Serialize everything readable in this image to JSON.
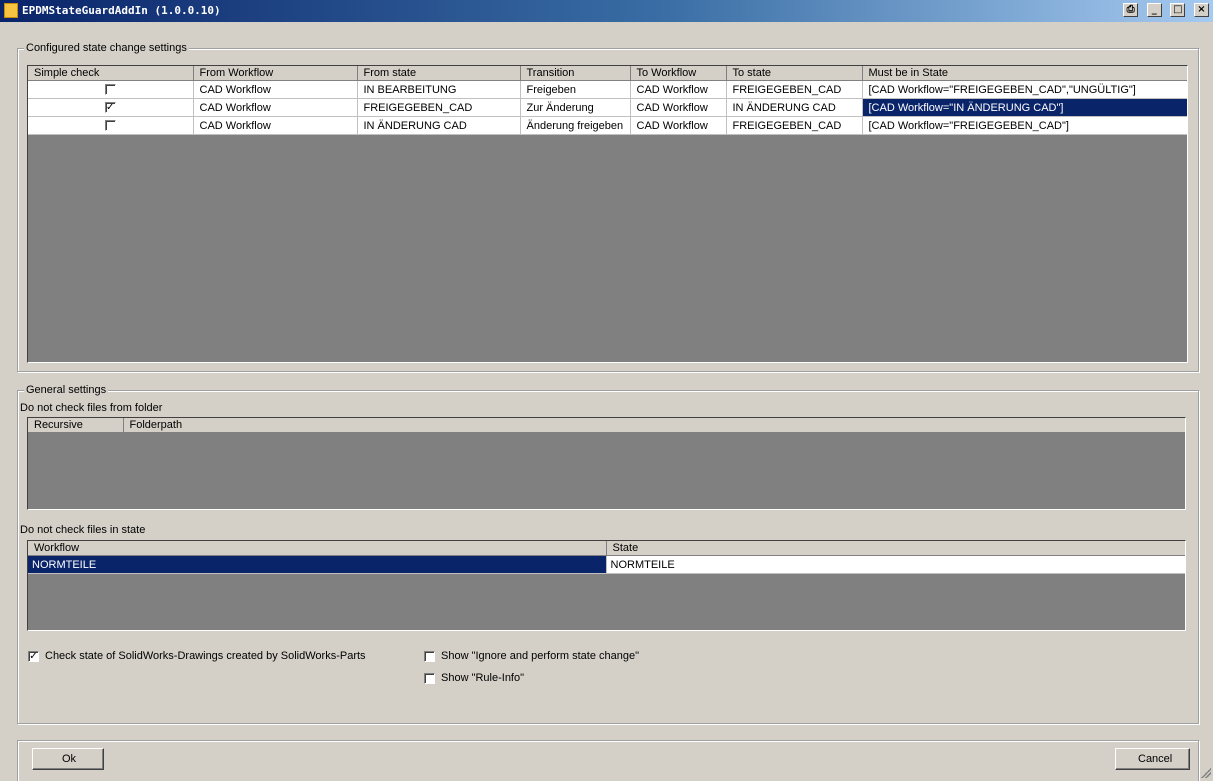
{
  "window": {
    "title": "EPDMStateGuardAddIn (1.0.0.10)",
    "icons": [
      "app-icon",
      "print-icon",
      "minimize-icon",
      "maximize-icon",
      "close-icon"
    ]
  },
  "state_changes": {
    "group_label": "Configured state change settings",
    "columns": [
      "Simple check",
      "From Workflow",
      "From state",
      "Transition",
      "To Workflow",
      "To state",
      "Must be in State"
    ],
    "rows": [
      {
        "simple_check": false,
        "from_workflow": "CAD Workflow",
        "from_state": "IN BEARBEITUNG",
        "transition": "Freigeben",
        "to_workflow": "CAD Workflow",
        "to_state": "FREIGEGEBEN_CAD",
        "must_be_in_state": "[CAD Workflow=\"FREIGEGEBEN_CAD\",\"UNGÜLTIG\"]",
        "selected": false
      },
      {
        "simple_check": true,
        "from_workflow": "CAD Workflow",
        "from_state": "FREIGEGEBEN_CAD",
        "transition": "Zur Änderung",
        "to_workflow": "CAD Workflow",
        "to_state": "IN ÄNDERUNG CAD",
        "must_be_in_state": "[CAD Workflow=\"IN ÄNDERUNG CAD\"]",
        "selected": true
      },
      {
        "simple_check": false,
        "from_workflow": "CAD Workflow",
        "from_state": "IN ÄNDERUNG CAD",
        "transition": "Änderung freigeben",
        "to_workflow": "CAD Workflow",
        "to_state": "FREIGEGEBEN_CAD",
        "must_be_in_state": "[CAD Workflow=\"FREIGEGEBEN_CAD\"]",
        "selected": false
      }
    ]
  },
  "general": {
    "group_label": "General settings",
    "folders_label": "Do not check files from folder",
    "folder_columns": [
      "Recursive",
      "Folderpath"
    ],
    "states_label": "Do not check files in state",
    "state_columns": [
      "Workflow",
      "State"
    ],
    "state_rows": [
      {
        "workflow": "NORMTEILE",
        "state": "NORMTEILE"
      }
    ],
    "check_drawings": {
      "label": "Check state of SolidWorks-Drawings created by SolidWorks-Parts",
      "checked": true
    },
    "show_ignore": {
      "label": "Show \"Ignore and perform state change\"",
      "checked": false
    },
    "show_rule_info": {
      "label": "Show \"Rule-Info\"",
      "checked": false
    }
  },
  "buttons": {
    "ok": "Ok",
    "cancel": "Cancel"
  }
}
